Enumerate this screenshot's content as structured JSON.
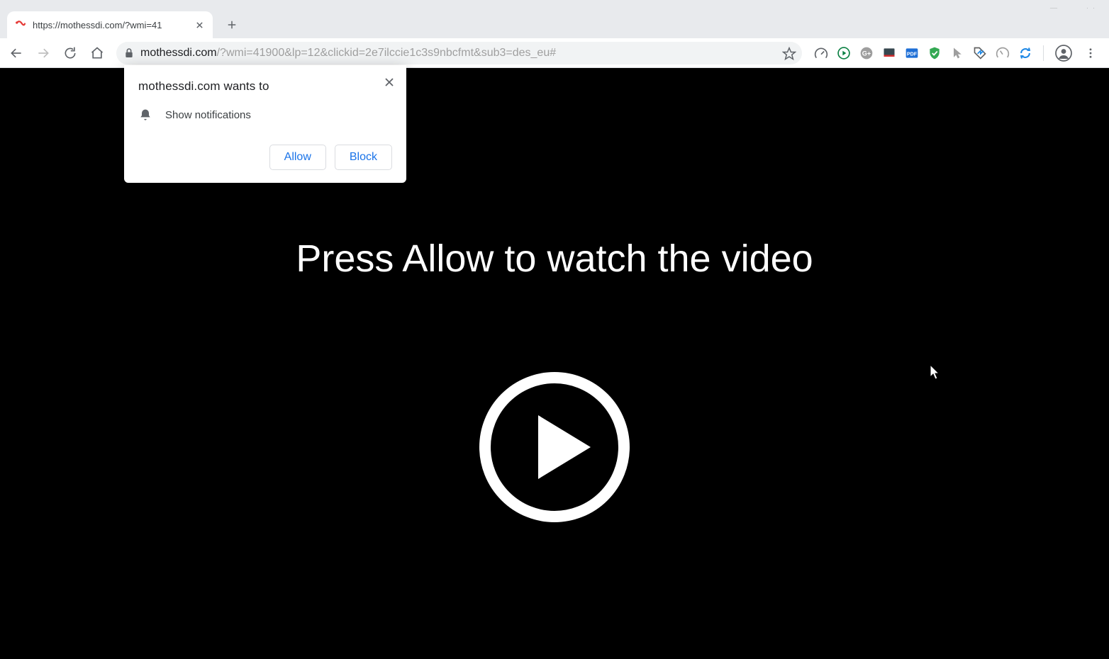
{
  "tab": {
    "title": "https://mothessdi.com/?wmi=41"
  },
  "url": {
    "host": "mothessdi.com",
    "path": "/?wmi=41900&lp=12&clickid=2e7ilccie1c3s9nbcfmt&sub3=des_eu#"
  },
  "page": {
    "headline": "Press Allow to watch the video"
  },
  "perm": {
    "title": "mothessdi.com wants to",
    "item": "Show notifications",
    "allow": "Allow",
    "block": "Block"
  }
}
